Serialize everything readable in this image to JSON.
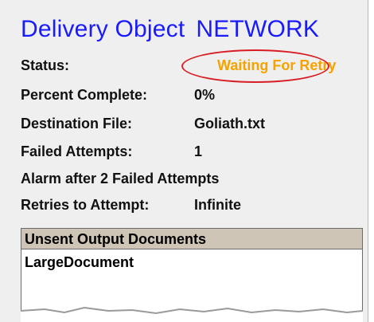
{
  "header": {
    "title": "Delivery Object",
    "object_name": "NETWORK"
  },
  "fields": {
    "status": {
      "label": "Status:",
      "value": "Waiting For Retry"
    },
    "percent_complete": {
      "label": "Percent Complete:",
      "value": "0%"
    },
    "destination_file": {
      "label": "Destination File:",
      "value": "Goliath.txt"
    },
    "failed_attempts": {
      "label": "Failed Attempts:",
      "value": "1"
    },
    "alarm_note": "Alarm after 2 Failed Attempts",
    "retries": {
      "label": "Retries to Attempt:",
      "value": "Infinite"
    }
  },
  "documents": {
    "header": "Unsent Output Documents",
    "items": [
      "LargeDocument"
    ]
  },
  "colors": {
    "title": "#1a1aff",
    "status": "#f4a300",
    "highlight": "#d81d24"
  }
}
